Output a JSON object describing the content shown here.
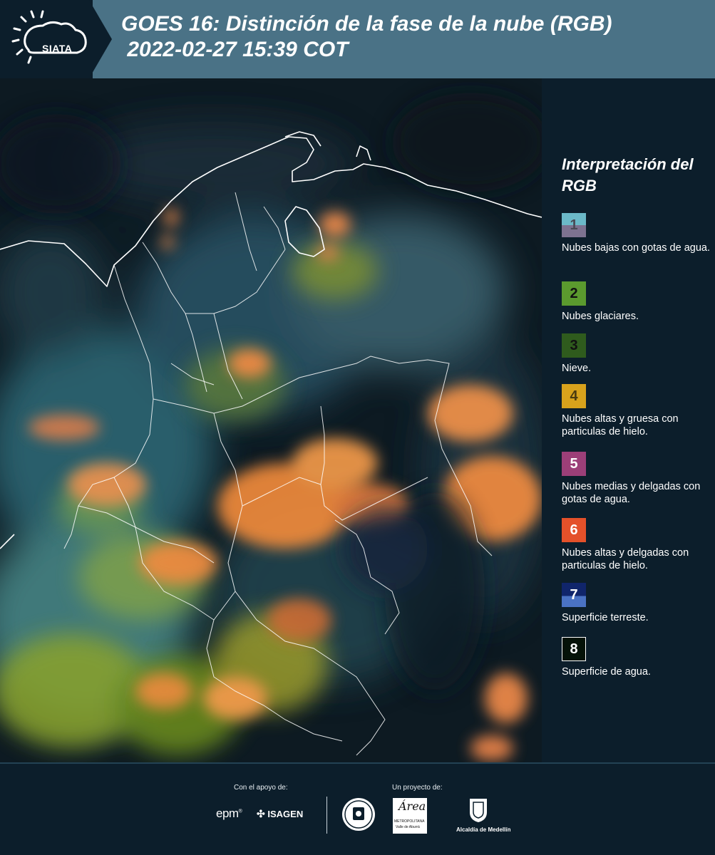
{
  "header": {
    "logo_text": "SIATA",
    "title_line1": "GOES 16: Distinción de la fase de la nube (RGB)",
    "title_line2": " 2022-02-27 15:39 COT"
  },
  "legend": {
    "title": "Interpretación del RGB",
    "items": [
      {
        "number": "1",
        "label": "Nubes bajas con gotas de agua.",
        "color_top": "#6bb9c8",
        "color_bottom": "#7d7290"
      },
      {
        "number": "2",
        "label": "Nubes glaciares.",
        "color_top": "#5b9a2e",
        "color_bottom": "#5b9a2e"
      },
      {
        "number": "3",
        "label": "Nieve.",
        "color_top": "#2f5b1d",
        "color_bottom": "#2f5b1d"
      },
      {
        "number": "4",
        "label": "Nubes altas y gruesa con particulas de hielo.",
        "color_top": "#d8a21c",
        "color_bottom": "#d8a21c"
      },
      {
        "number": "5",
        "label": "Nubes medias y delgadas con gotas de agua.",
        "color_top": "#9c3f78",
        "color_bottom": "#9c3f78"
      },
      {
        "number": "6",
        "label": "Nubes altas y delgadas con particulas de hielo.",
        "color_top": "#e4512a",
        "color_bottom": "#e4512a"
      },
      {
        "number": "7",
        "label": "Superficie terreste.",
        "color_top": "#10256b",
        "color_bottom": "#4a72c4"
      },
      {
        "number": "8",
        "label": "Superficie de agua.",
        "color_top": "#051208",
        "color_bottom": "#051208"
      }
    ]
  },
  "footer": {
    "support_caption": "Con el apoyo de:",
    "project_caption": "Un proyecto de:",
    "logo_epm": "epm",
    "logo_isagen": "ISAGEN",
    "logo_area_line1": "METROPOLITANA",
    "logo_area_line2": "Valle de Aburrá",
    "logo_alcaldia": "Alcaldía de Medellín"
  }
}
